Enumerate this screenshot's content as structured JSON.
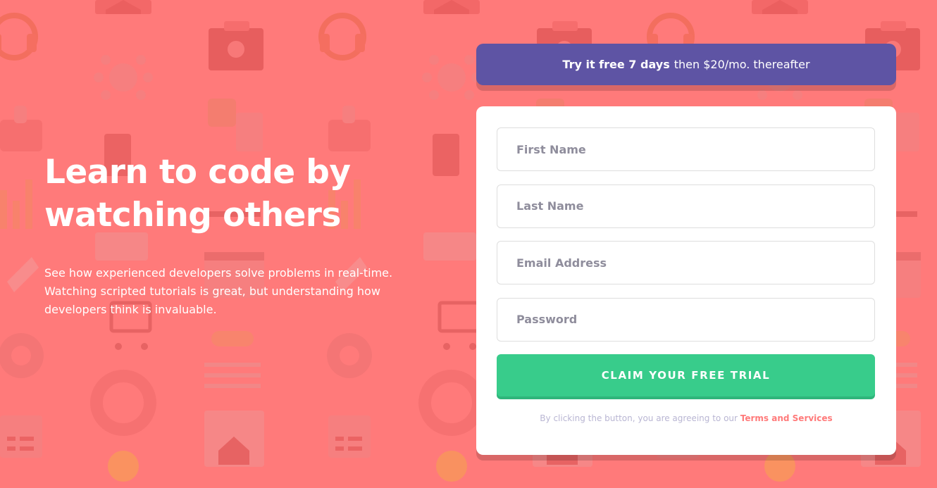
{
  "colors": {
    "background": "#ff7a7a",
    "banner": "#5e54a4",
    "button": "#38cc8b",
    "card": "#ffffff",
    "link": "#ff7a7a"
  },
  "background_icons": [
    "headset-icon",
    "house-icon",
    "network-icon",
    "thumbs-up-icon",
    "toolbox-icon",
    "chart-icon",
    "rocket-icon",
    "lifebuoy-icon",
    "gear-icon",
    "calendar-icon",
    "cart-icon",
    "browser-icon"
  ],
  "hero": {
    "title_line1": "Learn to code by",
    "title_line2": "watching others",
    "description": "See how experienced developers solve problems in real-time. Watching scripted tutorials is great, but understanding how developers think is invaluable."
  },
  "banner": {
    "bold_text": "Try it free 7 days",
    "rest_text": "then $20/mo. thereafter"
  },
  "form": {
    "first_name_placeholder": "First Name",
    "last_name_placeholder": "Last Name",
    "email_placeholder": "Email Address",
    "password_placeholder": "Password",
    "submit_label": "CLAIM YOUR FREE TRIAL",
    "terms_prefix": "By clicking the button, you are agreeing to our",
    "terms_link": "Terms and Services"
  }
}
